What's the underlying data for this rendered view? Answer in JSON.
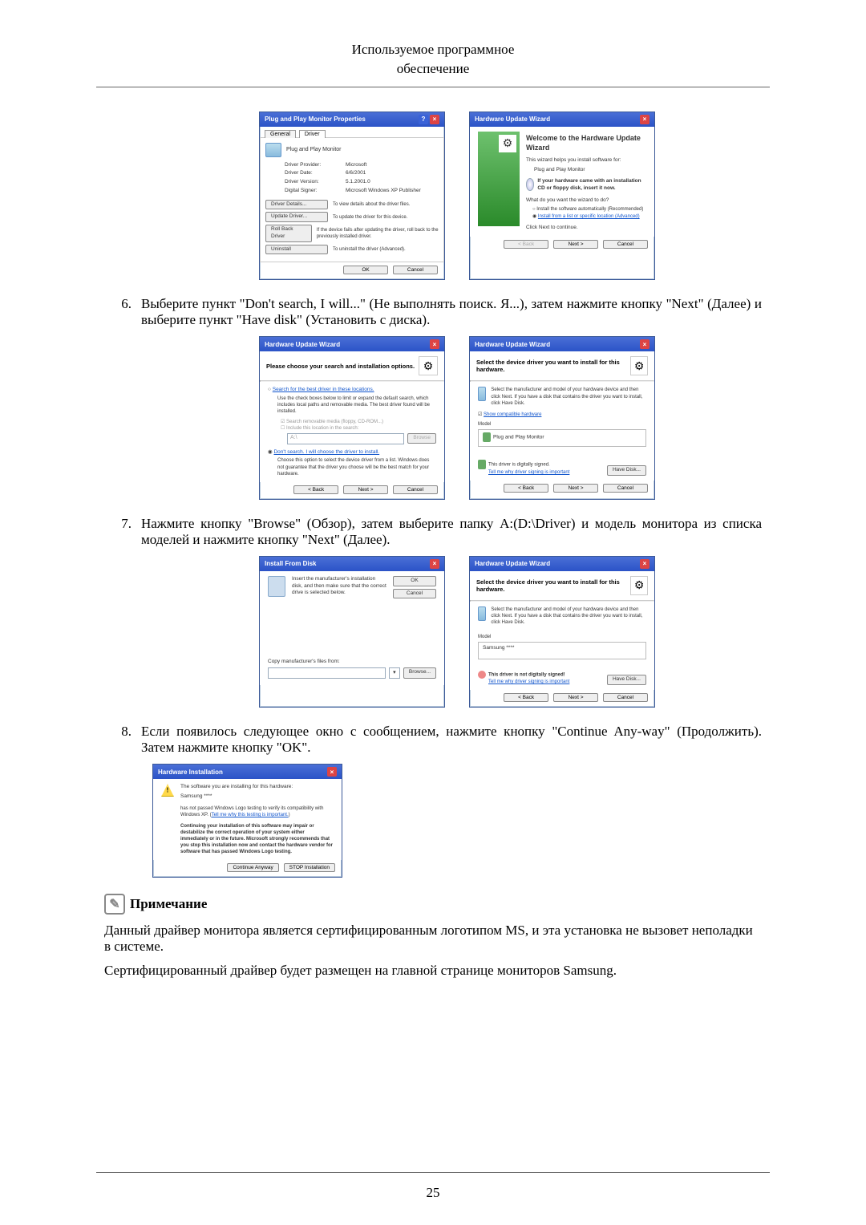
{
  "header": {
    "line1": "Используемое программное",
    "line2": "обеспечение"
  },
  "page_number": "25",
  "step6": {
    "num": "6.",
    "text": "Выберите пункт \"Don't search, I will...\" (Не выполнять поиск. Я...), затем нажмите кнопку \"Next\" (Далее) и выберите пункт \"Have disk\" (Установить с диска)."
  },
  "step7": {
    "num": "7.",
    "text": "Нажмите кнопку \"Browse\" (Обзор), затем выберите папку A:(D:\\Driver) и модель монитора из списка моделей и нажмите кнопку \"Next\" (Далее)."
  },
  "step8": {
    "num": "8.",
    "text": "Если  появилось  следующее  окно  с  сообщением,  нажмите  кнопку  \"Continue  Any-way\" (Продолжить). Затем нажмите кнопку \"OK\"."
  },
  "note": {
    "heading": "Примечание",
    "p1": "Данный драйвер монитора является сертифицированным логотипом MS, и эта установка не вызовет неполадки в системе.",
    "p2": "Сертифицированный драйвер будет размещен на главной странице мониторов Samsung."
  },
  "props": {
    "title": "Plug and Play Monitor Properties",
    "tab_general": "General",
    "tab_driver": "Driver",
    "device": "Plug and Play Monitor",
    "provider_lbl": "Driver Provider:",
    "provider": "Microsoft",
    "date_lbl": "Driver Date:",
    "date": "6/6/2001",
    "version_lbl": "Driver Version:",
    "version": "5.1.2001.0",
    "signer_lbl": "Digital Signer:",
    "signer": "Microsoft Windows XP Publisher",
    "btn_details": "Driver Details...",
    "details_txt": "To view details about the driver files.",
    "btn_update": "Update Driver...",
    "update_txt": "To update the driver for this device.",
    "btn_rollback": "Roll Back Driver",
    "rollback_txt": "If the device fails after updating the driver, roll back to the previously installed driver.",
    "btn_uninstall": "Uninstall",
    "uninstall_txt": "To uninstall the driver (Advanced).",
    "ok": "OK",
    "cancel": "Cancel"
  },
  "wiz1": {
    "title": "Hardware Update Wizard",
    "welcome": "Welcome to the Hardware Update Wizard",
    "intro": "This wizard helps you install software for:",
    "device": "Plug and Play Monitor",
    "cd": "If your hardware came with an installation CD or floppy disk, insert it now.",
    "question": "What do you want the wizard to do?",
    "opt1": "Install the software automatically (Recommended)",
    "opt2": "Install from a list or specific location (Advanced)",
    "cont": "Click Next to continue.",
    "back": "< Back",
    "next": "Next >",
    "cancel": "Cancel"
  },
  "wiz2": {
    "title": "Hardware Update Wizard",
    "heading": "Please choose your search and installation options.",
    "opt_search": "Search for the best driver in these locations.",
    "search_txt": "Use the check boxes below to limit or expand the default search, which includes local paths and removable media. The best driver found will be installed.",
    "chk1": "Search removable media (floppy, CD-ROM...)",
    "chk2": "Include this location in the search:",
    "path": "A:\\",
    "browse": "Browse",
    "opt_dont": "Don't search. I will choose the driver to install.",
    "dont_txt": "Choose this option to select the device driver from a list. Windows does not guarantee that the driver you choose will be the best match for your hardware.",
    "back": "< Back",
    "next": "Next >",
    "cancel": "Cancel"
  },
  "wiz3": {
    "title": "Hardware Update Wizard",
    "heading": "Select the device driver you want to install for this hardware.",
    "instr": "Select the manufacturer and model of your hardware device and then click Next. If you have a disk that contains the driver you want to install, click Have Disk.",
    "chk_compat": "Show compatible hardware",
    "model_lbl": "Model",
    "model": "Plug and Play Monitor",
    "signed": "This driver is digitally signed.",
    "tell": "Tell me why driver signing is important",
    "have_disk": "Have Disk...",
    "back": "< Back",
    "next": "Next >",
    "cancel": "Cancel"
  },
  "disk": {
    "title": "Install From Disk",
    "instr": "Insert the manufacturer's installation disk, and then make sure that the correct drive is selected below.",
    "ok": "OK",
    "cancel": "Cancel",
    "copy_lbl": "Copy manufacturer's files from:",
    "browse": "Browse..."
  },
  "wiz4": {
    "title": "Hardware Update Wizard",
    "heading": "Select the device driver you want to install for this hardware.",
    "instr": "Select the manufacturer and model of your hardware device and then click Next. If you have a disk that contains the driver you want to install, click Have Disk.",
    "model_lbl": "Model",
    "model": "Samsung ****",
    "unsigned": "This driver is not digitally signed!",
    "tell": "Tell me why driver signing is important",
    "have_disk": "Have Disk...",
    "back": "< Back",
    "next": "Next >",
    "cancel": "Cancel"
  },
  "hwi": {
    "title": "Hardware Installation",
    "l1": "The software you are installing for this hardware:",
    "l2": "Samsung ****",
    "l3a": "has not passed Windows Logo testing to verify its compatibility with Windows XP. (",
    "l3link": "Tell me why this testing is important.",
    "l3b": ")",
    "bold": "Continuing your installation of this software may impair or destabilize the correct operation of your system either immediately or in the future. Microsoft strongly recommends that you stop this installation now and contact the hardware vendor for software that has passed Windows Logo testing.",
    "cont": "Continue Anyway",
    "stop": "STOP Installation"
  }
}
